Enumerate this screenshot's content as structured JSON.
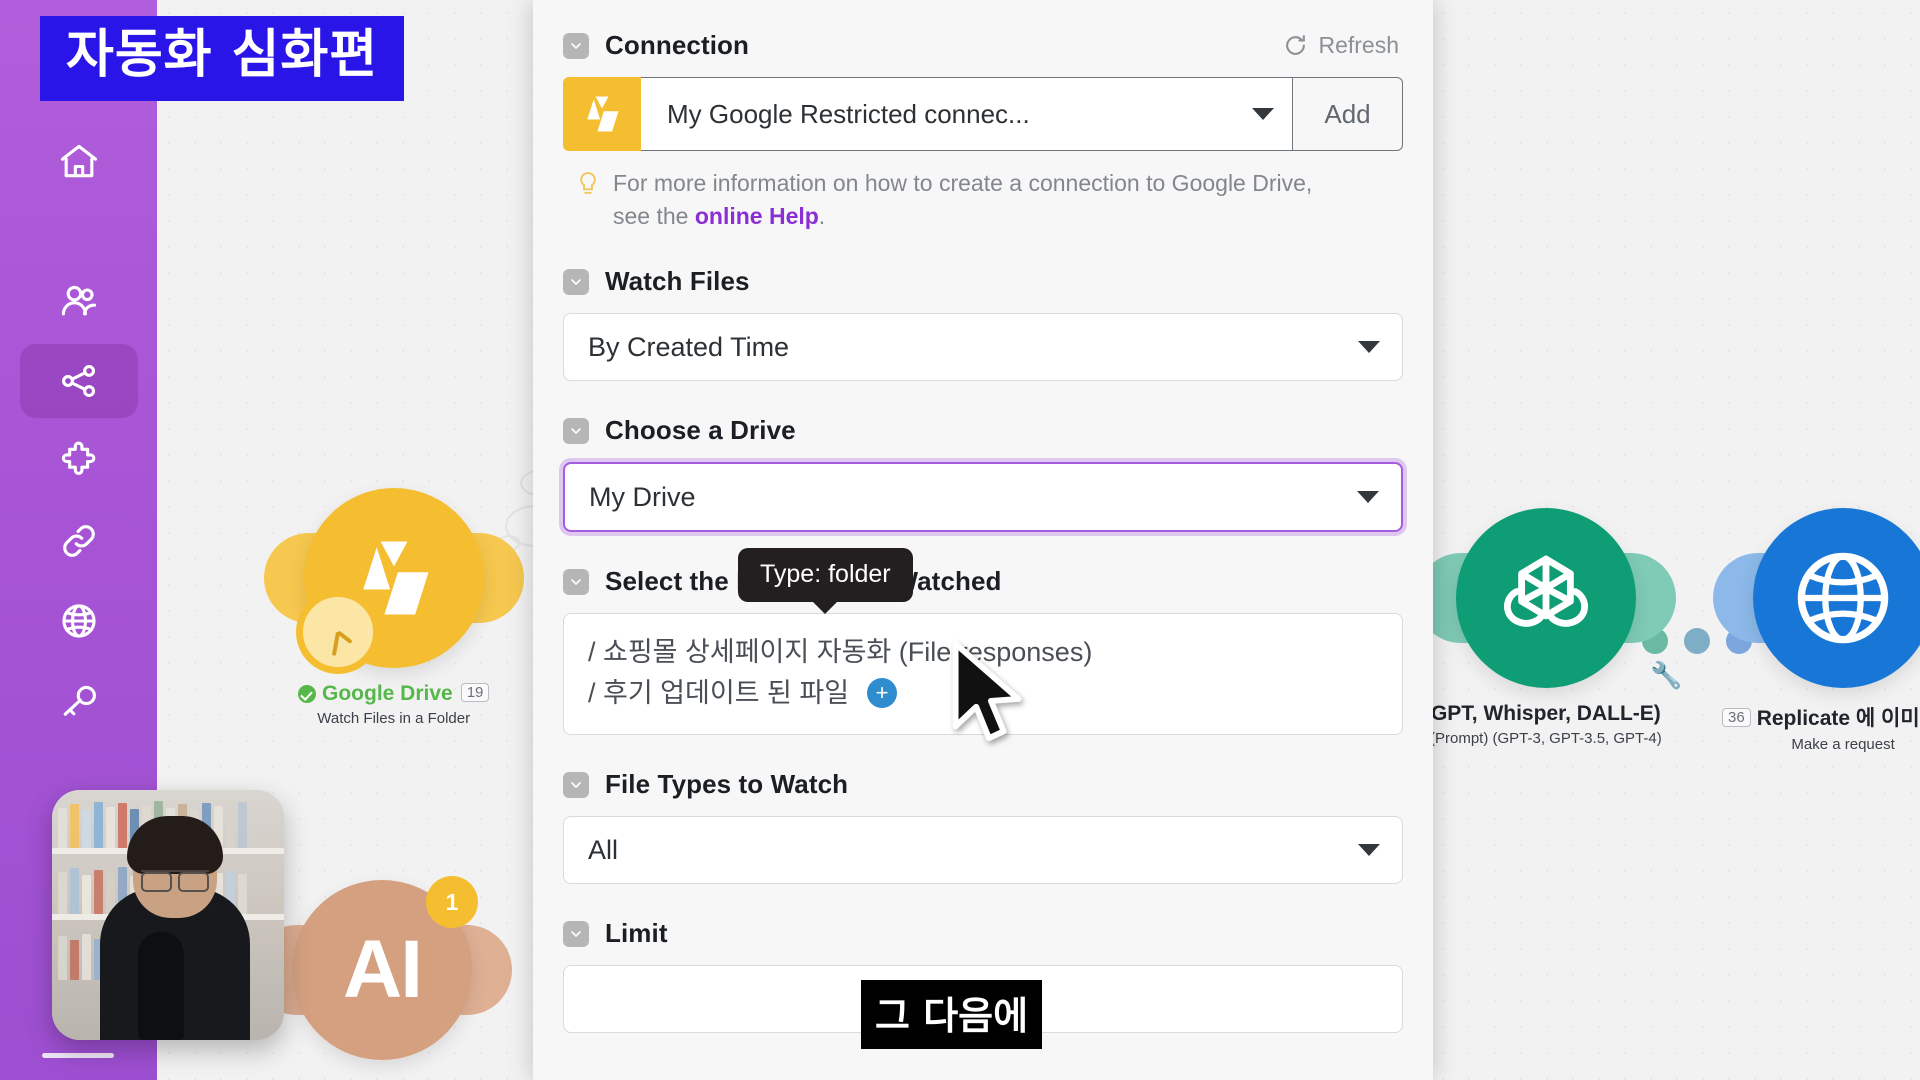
{
  "overlay": {
    "title_banner": "자동화 심화편",
    "caption": "그 다음에",
    "tooltip": "Type: folder"
  },
  "sidebar": {
    "items": [
      {
        "icon": "home-icon",
        "name": "home",
        "active": false
      },
      {
        "icon": "users-icon",
        "name": "team",
        "active": false
      },
      {
        "icon": "share-icon",
        "name": "scenarios",
        "active": true
      },
      {
        "icon": "puzzle-icon",
        "name": "templates",
        "active": false
      },
      {
        "icon": "link-icon",
        "name": "connections",
        "active": false
      },
      {
        "icon": "globe-icon",
        "name": "webhooks",
        "active": false
      },
      {
        "icon": "key-icon",
        "name": "keys",
        "active": false
      }
    ]
  },
  "canvas": {
    "modules": [
      {
        "id": "gdrive",
        "label": "Google Drive",
        "sub": "Watch Files in a Folder",
        "badge": "19",
        "status_check": true,
        "color": "#f5bd30"
      },
      {
        "id": "anthropic",
        "label": "",
        "sub": "",
        "badge": "1",
        "glyph": "AI",
        "color": "#d4a080"
      },
      {
        "id": "openai",
        "label": "GPT, Whisper, DALL-E)",
        "sub": "(Prompt) (GPT-3, GPT-3.5, GPT-4)",
        "badge": "",
        "color": "#0f9d76"
      },
      {
        "id": "replicate",
        "label": "Replicate 에 이미지 요",
        "sub": "Make a request",
        "badge": "36",
        "color": "#1877d6"
      }
    ]
  },
  "panel": {
    "sections": {
      "connection": {
        "title": "Connection",
        "refresh_label": "Refresh",
        "value": "My Google Restricted connec...",
        "add_label": "Add",
        "hint_part1": "For more information on how to create a connection to Google Drive, see the ",
        "hint_link": "online Help",
        "hint_part2": "."
      },
      "watch_files": {
        "title": "Watch Files",
        "value": "By Created Time"
      },
      "choose_drive": {
        "title": "Choose a Drive",
        "value": "My Drive"
      },
      "select_folder": {
        "title": "Select the Folder to be Watched",
        "path_line_1": "/  쇼핑몰 상세페이지 자동화 (File responses)",
        "path_line_2": "/  후기 업데이트 된 파일"
      },
      "file_types": {
        "title": "File Types to Watch",
        "value": "All"
      },
      "limit": {
        "title": "Limit",
        "value": ""
      }
    }
  },
  "colors": {
    "sidebar": "#a855d6",
    "accent_purple": "#8b2fd4",
    "focus_purple": "#a45ce0",
    "drive_yellow": "#f5bd30",
    "banner_blue": "#2a15e8"
  }
}
